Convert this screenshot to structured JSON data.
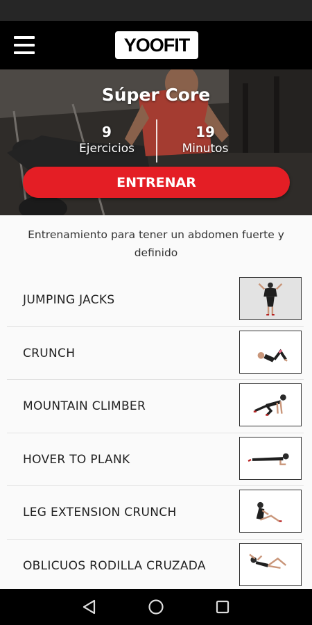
{
  "app": {
    "logo_text": "YOOFIT",
    "brand_red": "#e41e25"
  },
  "workout": {
    "title": "Súper Core",
    "exercises_count": "9",
    "exercises_label": "Ejercicios",
    "minutes_count": "19",
    "minutes_label": "Minutos",
    "train_button": "ENTRENAR",
    "description": "Entrenamiento para tener un abdomen fuerte y definido"
  },
  "exercises": [
    {
      "name": "JUMPING JACKS",
      "pose": "standing"
    },
    {
      "name": "CRUNCH",
      "pose": "crunch"
    },
    {
      "name": "MOUNTAIN CLIMBER",
      "pose": "climber"
    },
    {
      "name": "HOVER TO PLANK",
      "pose": "plank"
    },
    {
      "name": "LEG EXTENSION CRUNCH",
      "pose": "seated"
    },
    {
      "name": "OBLICUOS RODILLA CRUZADA",
      "pose": "lying"
    }
  ],
  "icons": {
    "menu": "hamburger-menu-icon",
    "back": "back-triangle-icon",
    "home": "home-circle-icon",
    "recent": "recent-apps-square-icon"
  }
}
